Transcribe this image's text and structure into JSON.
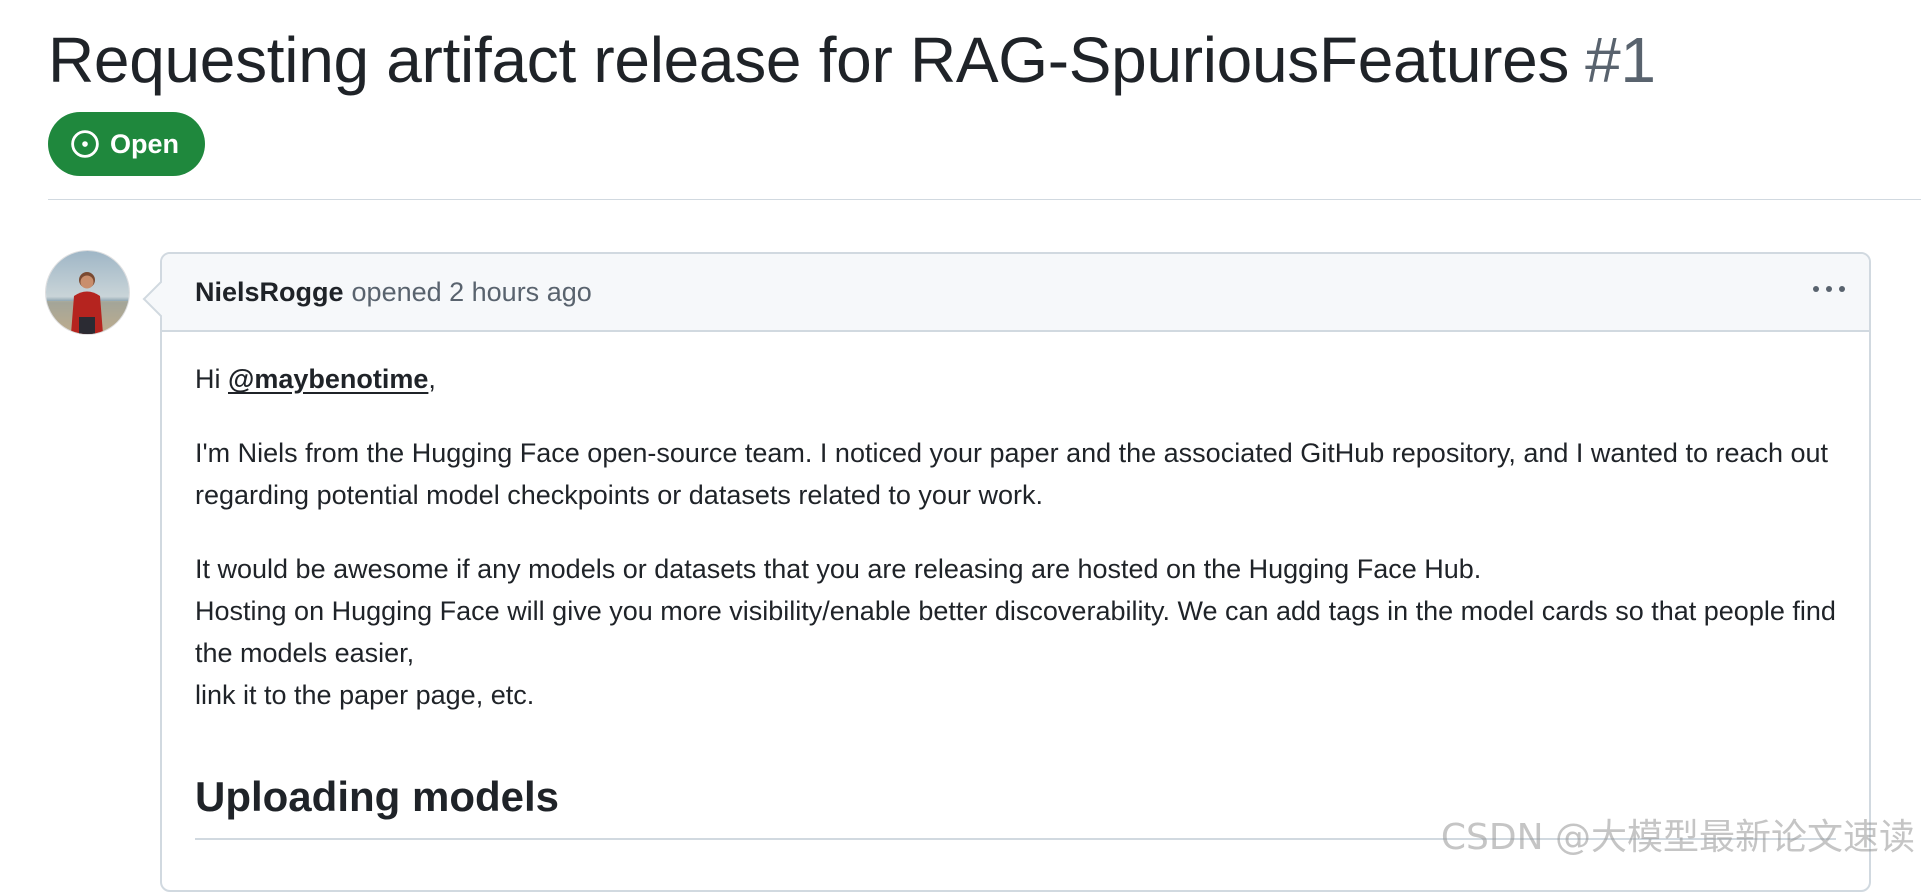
{
  "issue": {
    "title": "Requesting artifact release for RAG-SpuriousFeatures",
    "number": "#1",
    "state": "Open",
    "state_color": "#1f883d"
  },
  "comment": {
    "author": "NielsRogge",
    "meta": "opened 2 hours ago",
    "greeting_prefix": "Hi ",
    "mention": "@maybenotime",
    "greeting_suffix": ",",
    "para1": "I'm Niels from the Hugging Face open-source team. I noticed your paper and the associated GitHub repository, and I wanted to reach out regarding potential model checkpoints or datasets related to your work.",
    "para2_line1": "It would be awesome if any models or datasets that you are releasing are hosted on the Hugging Face Hub.",
    "para2_line2": "Hosting on Hugging Face will give you more visibility/enable better discoverability. We can add tags in the model cards so that people find the models easier,",
    "para2_line3": "link it to the paper page, etc.",
    "heading": "Uploading models",
    "menu_icon": "kebab-horizontal-icon"
  },
  "watermark": "CSDN @大模型最新论文速读"
}
